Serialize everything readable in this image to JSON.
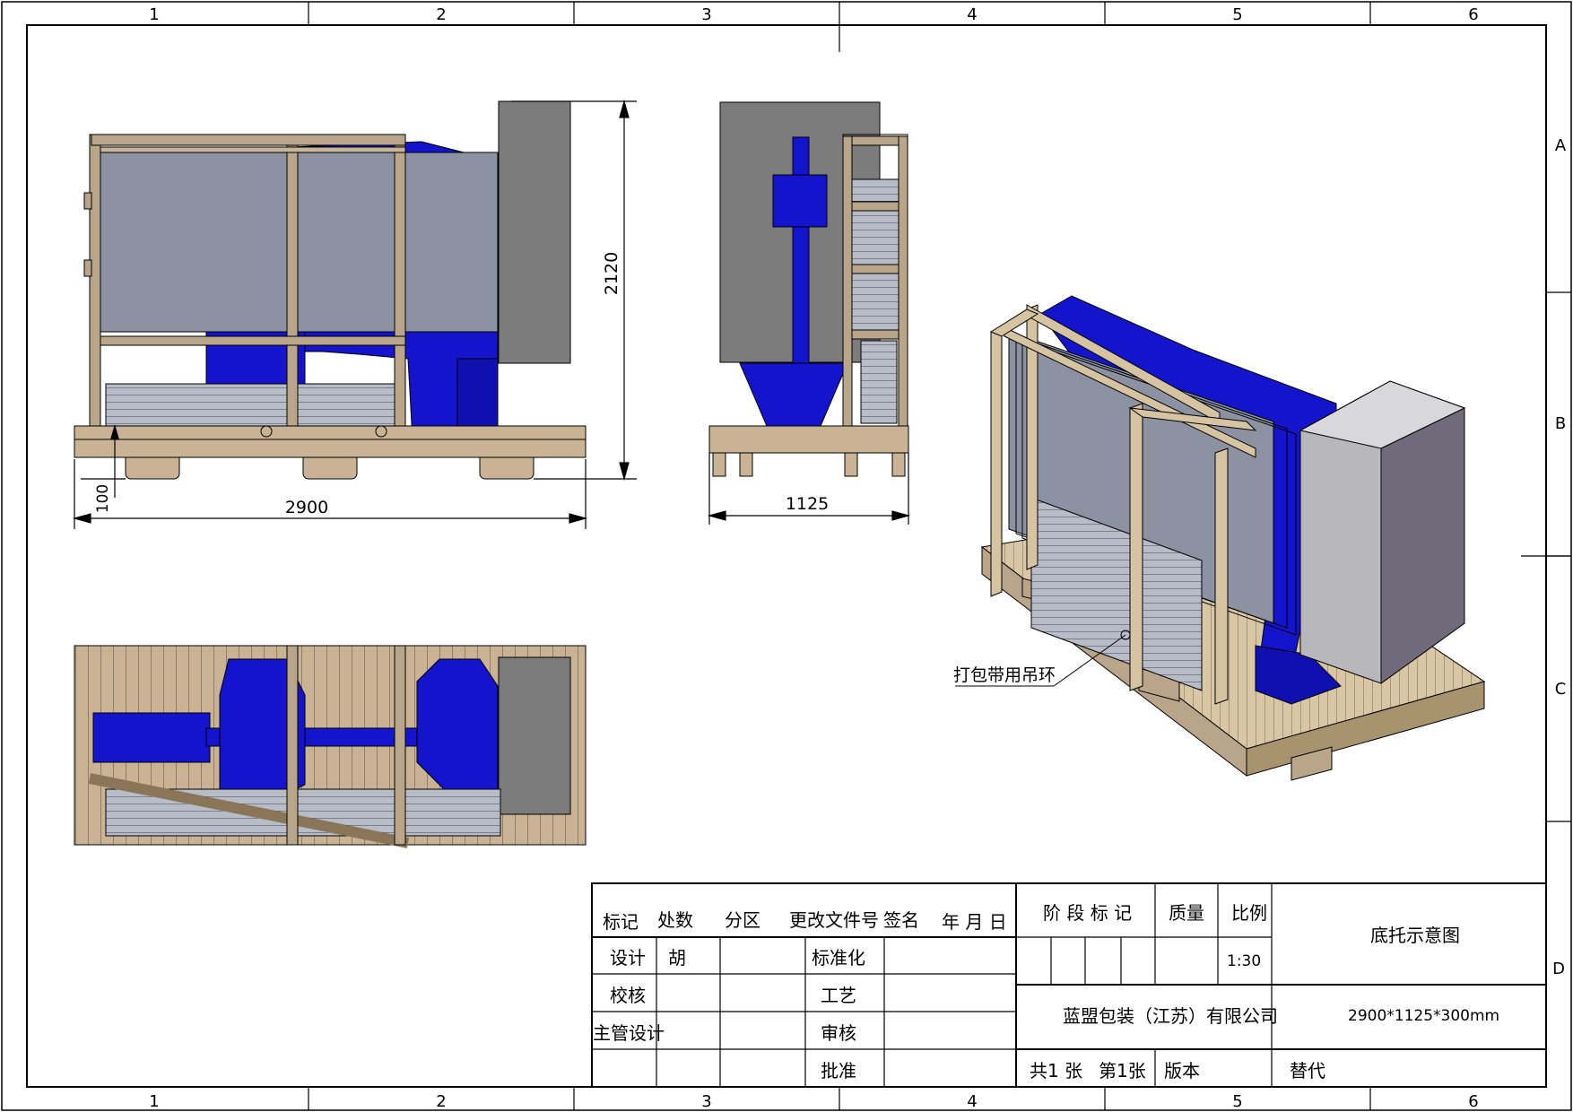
{
  "zones": {
    "columns": [
      "1",
      "2",
      "3",
      "4",
      "5",
      "6"
    ],
    "rows": [
      "A",
      "B",
      "C",
      "D"
    ]
  },
  "dimensions": {
    "front_length": "2900",
    "front_height": "2120",
    "front_clearance": "100",
    "side_width": "1125"
  },
  "callout": "打包带用吊环",
  "title_block": {
    "rev_headers": [
      "标记",
      "处数",
      "分区",
      "更改文件号",
      "签名",
      "年 月 日"
    ],
    "roles": [
      "设计",
      "校核",
      "主管设计"
    ],
    "designer": "胡",
    "approvals": [
      "标准化",
      "工艺",
      "审核",
      "批准"
    ],
    "stage_mark": "阶 段 标 记",
    "mass": "质量",
    "scale_label": "比例",
    "scale_value": "1:30",
    "title": "底托示意图",
    "company": "蓝盟包装（江苏）有限公司",
    "size": "2900*1125*300mm",
    "sheets_total": "共1 张",
    "sheet_no": "第1张",
    "version": "版本",
    "replace": "替代"
  },
  "colors": {
    "wood": "#b9a58a",
    "wood_light": "#e8d7b8",
    "machine_blue": "#1010cc",
    "panel_gray": "#8a90a0",
    "cabinet_gray": "#7a7a7a",
    "line": "#000000"
  }
}
